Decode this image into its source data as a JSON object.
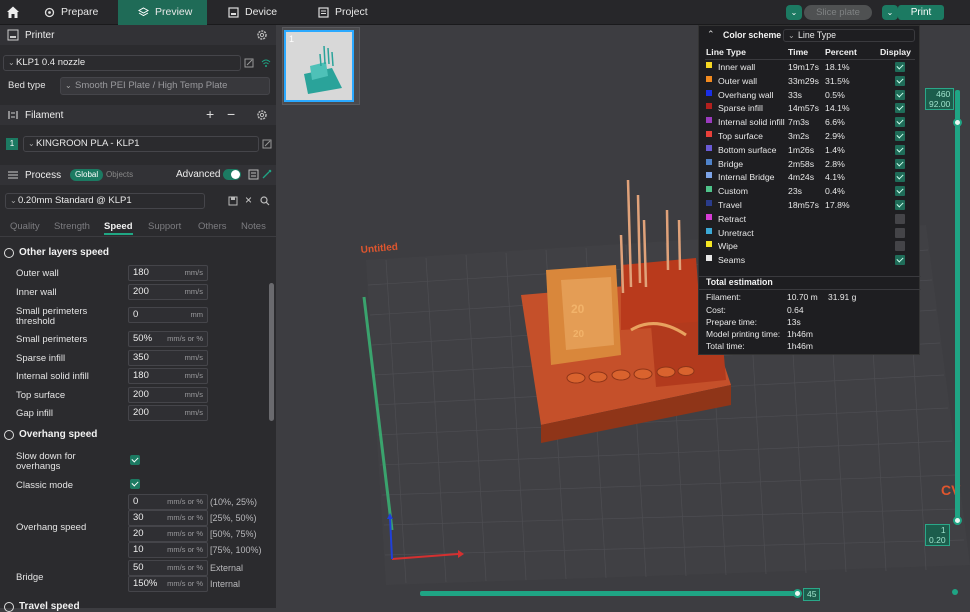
{
  "topbar": {
    "tabs": [
      "Prepare",
      "Preview",
      "Device",
      "Project"
    ],
    "slice_label": "Slice plate",
    "print_label": "Print"
  },
  "printer": {
    "title": "Printer",
    "nozzle": "KLP1 0.4 nozzle",
    "bed_label": "Bed type",
    "bed_value": "Smooth PEI Plate / High Temp Plate"
  },
  "filament": {
    "title": "Filament",
    "slot": "1",
    "name": "KINGROON PLA - KLP1"
  },
  "process": {
    "title": "Process",
    "global": "Global",
    "objects": "Objects",
    "advanced": "Advanced",
    "preset": "0.20mm Standard @ KLP1",
    "tabs": [
      "Quality",
      "Strength",
      "Speed",
      "Support",
      "Others",
      "Notes"
    ]
  },
  "other_speed": {
    "title": "Other layers speed",
    "rows": [
      {
        "label": "Outer wall",
        "value": "180",
        "unit": "mm/s"
      },
      {
        "label": "Inner wall",
        "value": "200",
        "unit": "mm/s"
      },
      {
        "label": "Small perimeters threshold",
        "label1": "Small perimeters",
        "label2": "threshold",
        "value": "0",
        "unit": "mm"
      },
      {
        "label": "Small perimeters",
        "value": "50%",
        "unit": "mm/s or %"
      },
      {
        "label": "Sparse infill",
        "value": "350",
        "unit": "mm/s"
      },
      {
        "label": "Internal solid infill",
        "value": "180",
        "unit": "mm/s"
      },
      {
        "label": "Top surface",
        "value": "200",
        "unit": "mm/s"
      },
      {
        "label": "Gap infill",
        "value": "200",
        "unit": "mm/s"
      }
    ]
  },
  "overhang": {
    "title": "Overhang speed",
    "slow_label1": "Slow down for",
    "slow_label2": "overhangs",
    "classic_label": "Classic mode",
    "speed_label": "Overhang speed",
    "unit": "mm/s or %",
    "speeds": [
      {
        "value": "0",
        "range": "(10%, 25%)"
      },
      {
        "value": "30",
        "range": "[25%, 50%)"
      },
      {
        "value": "20",
        "range": "[50%, 75%)"
      },
      {
        "value": "10",
        "range": "[75%, 100%)"
      }
    ],
    "bridge_label": "Bridge",
    "bridge_external": "50",
    "bridge_external_label": "External",
    "bridge_internal": "150%",
    "bridge_internal_label": "Internal"
  },
  "travel": {
    "title": "Travel speed"
  },
  "viewport": {
    "plate_number": "1",
    "plate_label": "Untitled",
    "top_value": "460",
    "top_height": "92.00",
    "bottom_value": "1",
    "bottom_height": "0.20",
    "hslider_value": "45"
  },
  "color_scheme": {
    "title": "Color scheme",
    "mode": "Line Type",
    "headers": [
      "Line Type",
      "Time",
      "Percent",
      "Display"
    ],
    "rows": [
      {
        "name": "Inner wall",
        "time": "19m17s",
        "percent": "18.1%",
        "color": "#f5d623",
        "display": true
      },
      {
        "name": "Outer wall",
        "time": "33m29s",
        "percent": "31.5%",
        "color": "#f28a1f",
        "display": true
      },
      {
        "name": "Overhang wall",
        "time": "33s",
        "percent": "0.5%",
        "color": "#1a2fe6",
        "display": true
      },
      {
        "name": "Sparse infill",
        "time": "14m57s",
        "percent": "14.1%",
        "color": "#b2201e",
        "display": true
      },
      {
        "name": "Internal solid infill",
        "time": "7m3s",
        "percent": "6.6%",
        "color": "#9b3bbf",
        "display": true
      },
      {
        "name": "Top surface",
        "time": "3m2s",
        "percent": "2.9%",
        "color": "#e8403a",
        "display": true
      },
      {
        "name": "Bottom surface",
        "time": "1m26s",
        "percent": "1.4%",
        "color": "#6a5bd6",
        "display": true
      },
      {
        "name": "Bridge",
        "time": "2m58s",
        "percent": "2.8%",
        "color": "#4f82c9",
        "display": true
      },
      {
        "name": "Internal Bridge",
        "time": "4m24s",
        "percent": "4.1%",
        "color": "#7da4e8",
        "display": true
      },
      {
        "name": "Custom",
        "time": "23s",
        "percent": "0.4%",
        "color": "#4fc38a",
        "display": true
      },
      {
        "name": "Travel",
        "time": "18m57s",
        "percent": "17.8%",
        "color": "#2a3c8c",
        "display": true
      },
      {
        "name": "Retract",
        "time": "",
        "percent": "",
        "color": "#d63cd6",
        "display": false
      },
      {
        "name": "Unretract",
        "time": "",
        "percent": "",
        "color": "#3ca9d6",
        "display": false
      },
      {
        "name": "Wipe",
        "time": "",
        "percent": "",
        "color": "#f5e623",
        "display": false
      },
      {
        "name": "Seams",
        "time": "",
        "percent": "",
        "color": "#e8e8e8",
        "display": true
      }
    ],
    "total_title": "Total estimation",
    "totals": [
      {
        "label": "Filament:",
        "value": "10.70 m",
        "extra": "31.91 g"
      },
      {
        "label": "Cost:",
        "value": "0.64",
        "extra": ""
      },
      {
        "label": "Prepare time:",
        "value": "13s",
        "extra": ""
      },
      {
        "label": "Model printing time:",
        "value": "1h46m",
        "extra": ""
      },
      {
        "label": "Total time:",
        "value": "1h46m",
        "extra": ""
      }
    ]
  }
}
